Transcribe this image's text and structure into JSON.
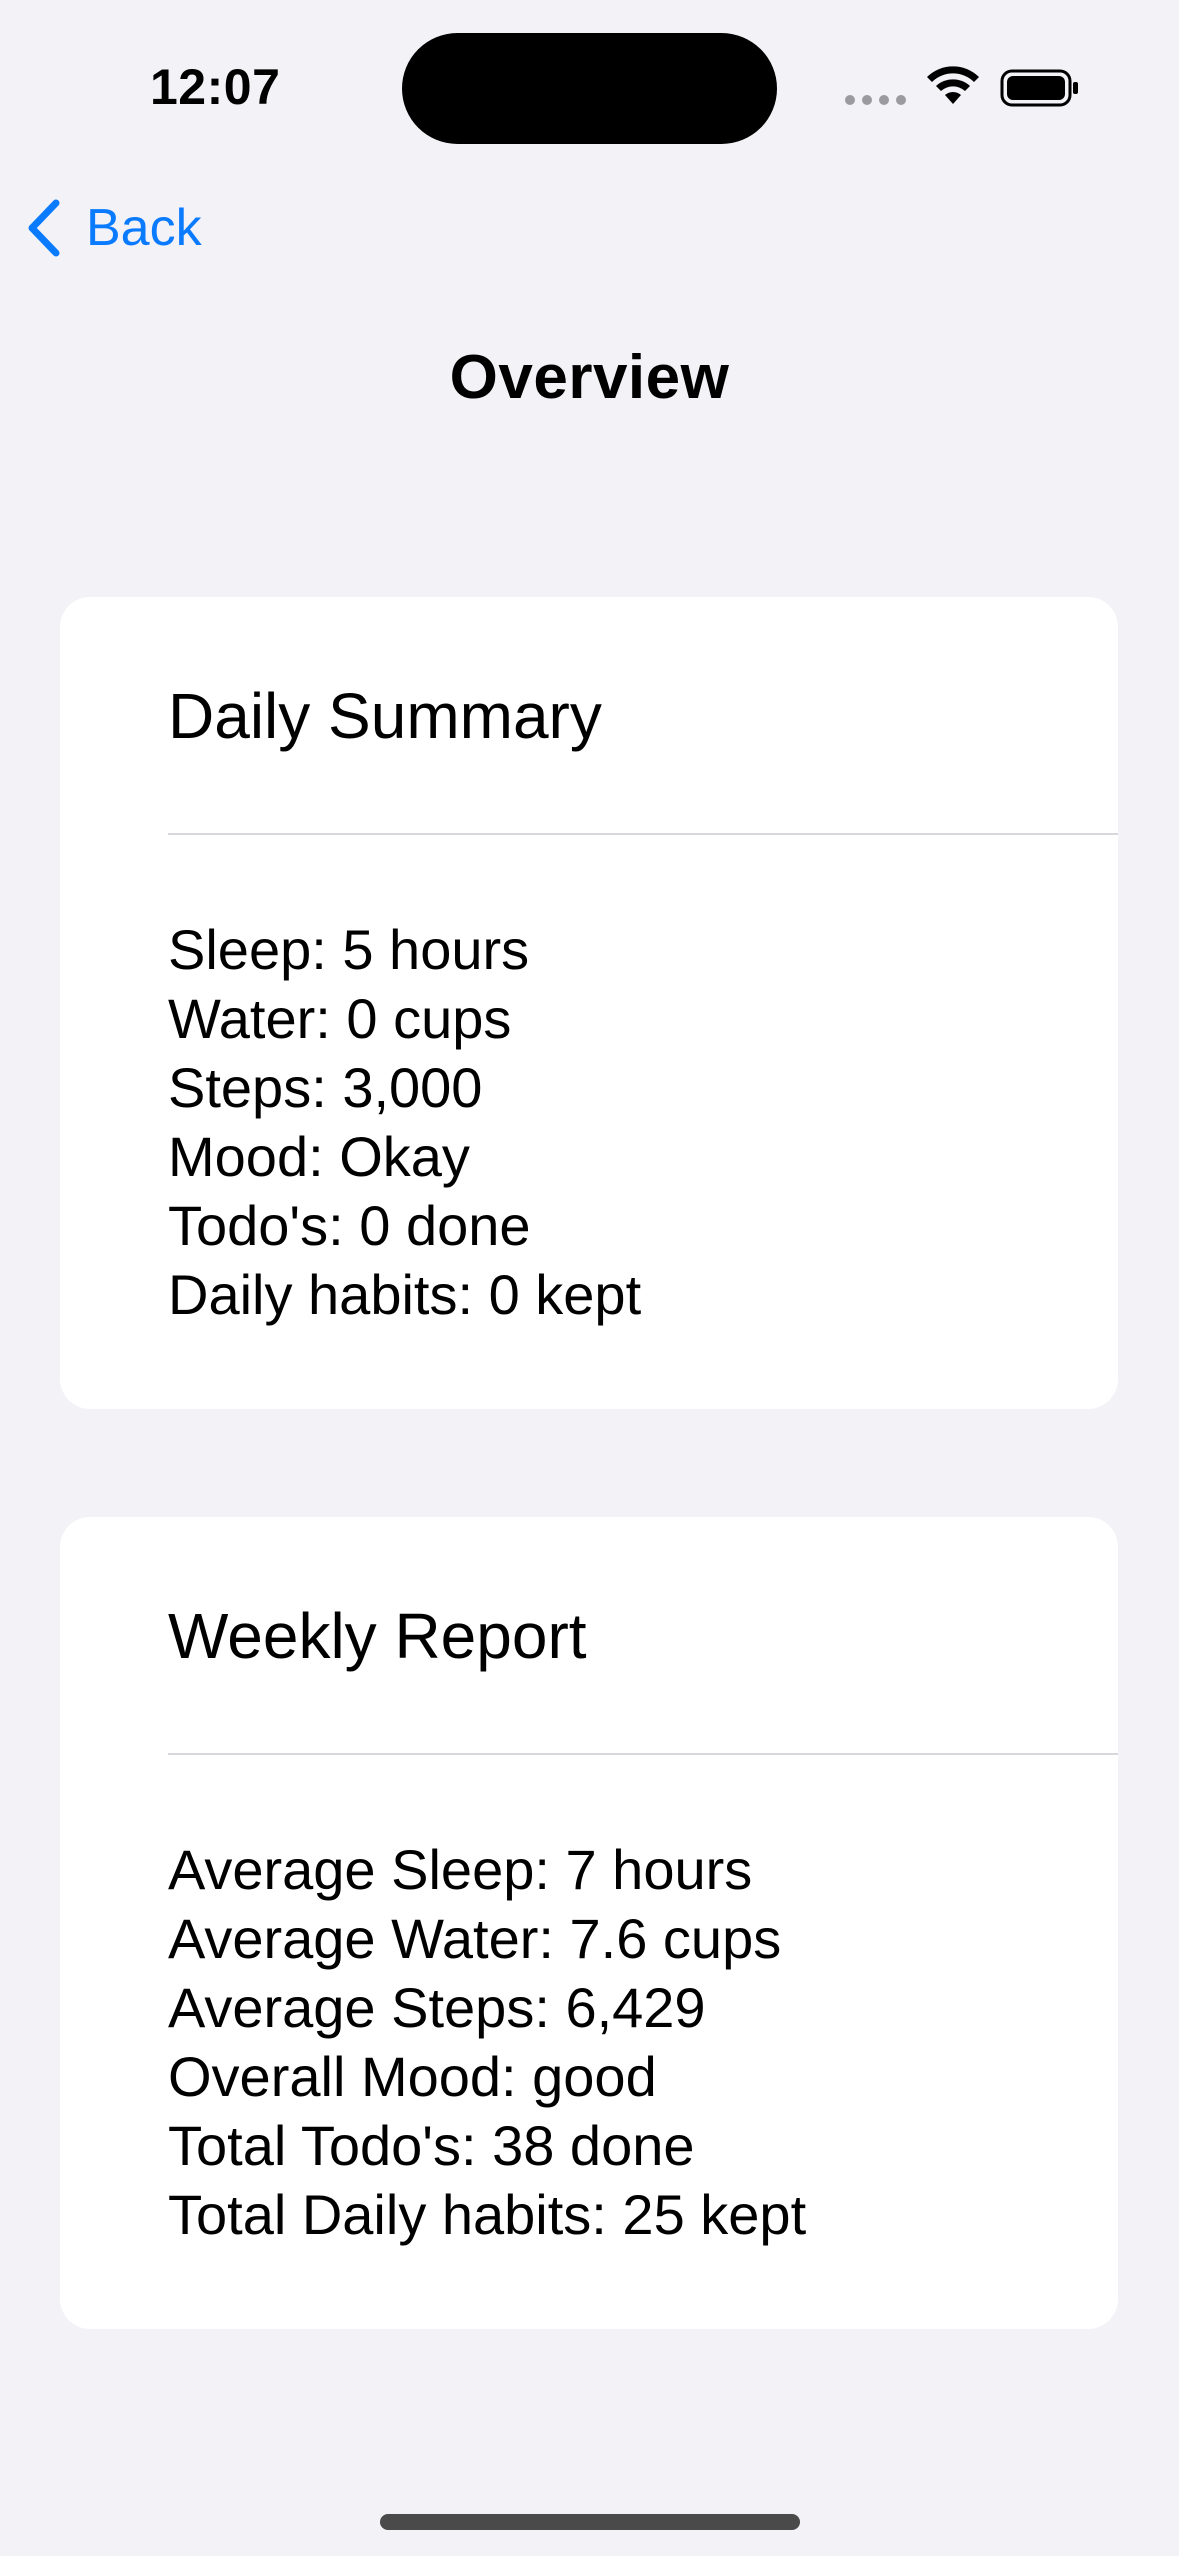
{
  "status_bar": {
    "time": "12:07"
  },
  "nav": {
    "back_label": "Back",
    "title": "Overview"
  },
  "colors": {
    "accent": "#0a7aff",
    "background": "#f2f2f7",
    "card": "#ffffff"
  },
  "daily_summary": {
    "heading": "Daily Summary",
    "lines": [
      "Sleep: 5 hours",
      "Water: 0 cups",
      "Steps: 3,000",
      "Mood: Okay",
      "Todo's: 0 done",
      "Daily habits: 0 kept"
    ]
  },
  "weekly_report": {
    "heading": "Weekly Report",
    "lines": [
      "Average Sleep: 7 hours",
      "Average Water: 7.6 cups",
      "Average Steps: 6,429",
      "Overall Mood: good",
      "Total Todo's: 38 done",
      "Total Daily habits: 25 kept"
    ]
  },
  "icons": {
    "back": "chevron-left-icon",
    "wifi": "wifi-icon",
    "battery": "battery-icon",
    "signal": "cellular-signal-icon"
  }
}
